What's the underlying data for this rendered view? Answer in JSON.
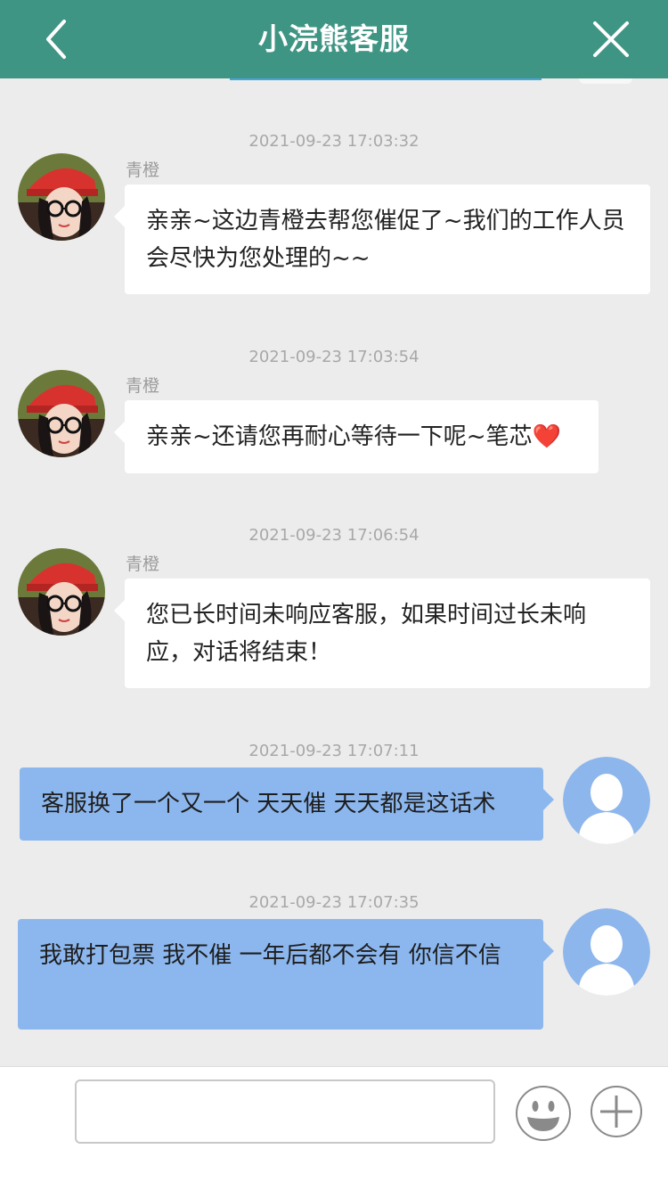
{
  "header": {
    "title": "小浣熊客服"
  },
  "messages": [
    {
      "timestamp": "2021-09-23 17:03:32",
      "sender": "青橙",
      "text": "亲亲~这边青橙去帮您催促了~我们的工作人员会尽快为您处理的~~"
    },
    {
      "timestamp": "2021-09-23 17:03:54",
      "sender": "青橙",
      "text": "亲亲~还请您再耐心等待一下呢~笔芯❤️"
    },
    {
      "timestamp": "2021-09-23 17:06:54",
      "sender": "青橙",
      "text": "您已长时间未响应客服，如果时间过长未响应，对话将结束！"
    },
    {
      "timestamp": "2021-09-23 17:07:11",
      "text": "客服换了一个又一个 天天催 天天都是这话术"
    },
    {
      "timestamp": "2021-09-23 17:07:35",
      "text": "我敢打包票 我不催 一年后都不会有 你信不信"
    }
  ],
  "input": {
    "value": "",
    "placeholder": ""
  },
  "icons": {
    "back": "chevron-left-icon",
    "close": "close-icon",
    "emoji": "emoji-icon",
    "plus": "plus-icon"
  },
  "colors": {
    "header_bg": "#3f9584",
    "background": "#ececec",
    "user_bubble": "#8cb7ee",
    "agent_bubble": "#ffffff"
  }
}
